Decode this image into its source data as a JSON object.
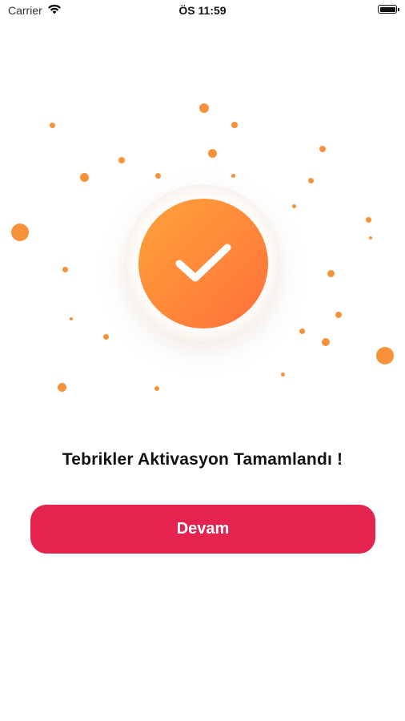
{
  "status_bar": {
    "carrier": "Carrier",
    "time": "ÖS 11:59",
    "wifi_icon": "wifi-icon",
    "battery_icon": "battery-icon"
  },
  "illustration": {
    "icon": "checkmark-icon",
    "accent_color": "#f7923a",
    "circle_gradient": [
      "#ffa23a",
      "#ff6f3a"
    ]
  },
  "message": {
    "text": "Tebrikler Aktivasyon Tamamlandı !"
  },
  "actions": {
    "continue_label": "Devam",
    "button_color": "#e5234f"
  }
}
